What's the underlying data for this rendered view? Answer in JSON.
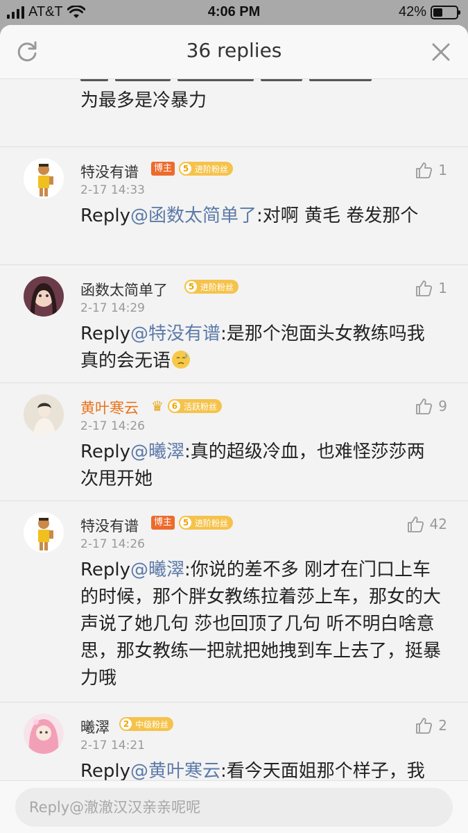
{
  "status": {
    "carrier": "AT&T",
    "time": "4:06 PM",
    "battery_text": "42%",
    "battery_level": 0.42
  },
  "header": {
    "title": "36 replies"
  },
  "cut_comment": {
    "text": "为最多是冷暴力"
  },
  "comments": [
    {
      "name": "特没有谱",
      "host_badge": "博主",
      "fan_level": "5",
      "fan_label": "进阶粉丝",
      "date": "2-17 14:33",
      "likes": "1",
      "prefix": "Reply",
      "mention": "@函数太简单了",
      "text": ":对啊 黄毛 卷发那个"
    },
    {
      "name": "函数太简单了",
      "fan_level": "5",
      "fan_label": "进阶粉丝",
      "date": "2-17 14:29",
      "likes": "1",
      "prefix": "Reply",
      "mention": "@特没有谱",
      "text": ":是那个泡面头女教练吗我真的会无语"
    },
    {
      "name": "黄叶寒云",
      "fan_level": "6",
      "fan_label": "活跃粉丝",
      "date": "2-17 14:26",
      "likes": "9",
      "prefix": "Reply",
      "mention": "@曦濢",
      "text": ":真的超级冷血，也难怪莎莎两次甩开她"
    },
    {
      "name": "特没有谱",
      "host_badge": "博主",
      "fan_level": "5",
      "fan_label": "进阶粉丝",
      "date": "2-17 14:26",
      "likes": "42",
      "prefix": "Reply",
      "mention": "@曦濢",
      "text": ":你说的差不多 刚才在门口上车的时候，那个胖女教练拉着莎上车，那女的大声说了她几句 莎也回顶了几句 听不明白啥意思，那女教练一把就把她拽到车上去了，挺暴力哦"
    },
    {
      "name": "曦濢",
      "fan_level": "2",
      "fan_label": "中级粉丝",
      "date": "2-17 14:21",
      "likes": "2",
      "prefix": "Reply",
      "mention": "@黄叶寒云",
      "text": ":看今天面姐那个样子，我真的心疼莎莎，她真的就是冷血"
    }
  ],
  "reply_bar": {
    "placeholder": "Reply@澈澈汉汉亲亲呢呢"
  }
}
